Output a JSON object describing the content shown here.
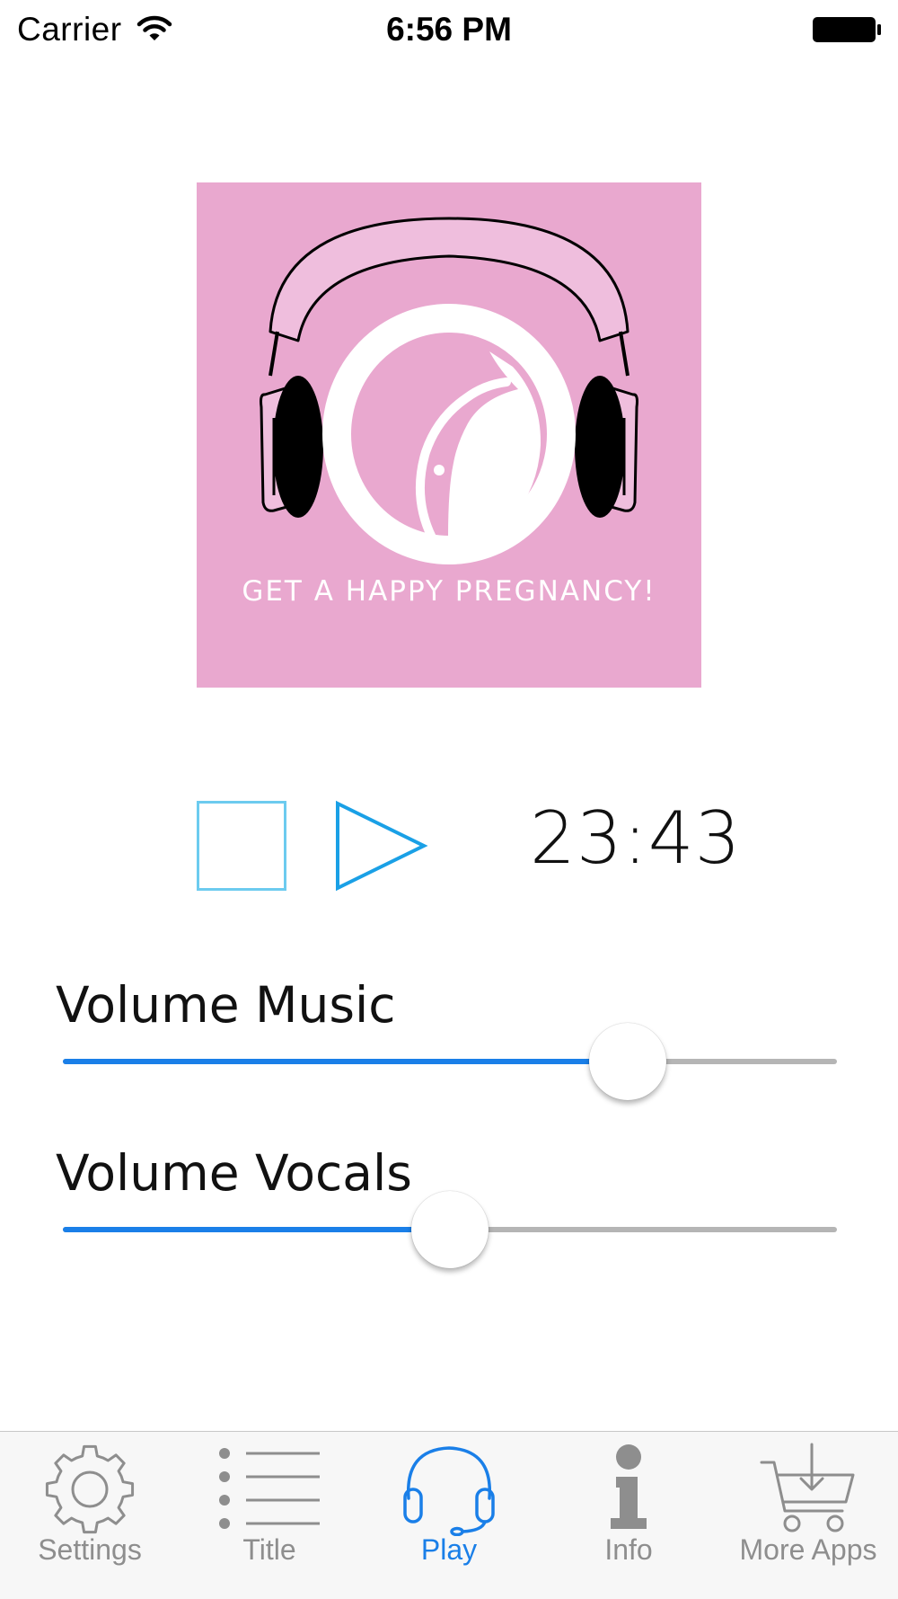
{
  "status_bar": {
    "carrier": "Carrier",
    "time": "6:56 PM"
  },
  "artwork": {
    "tagline": "GET A HAPPY PREGNANCY!",
    "background_color": "#e9a8cf"
  },
  "player": {
    "stop_icon": "stop-square-icon",
    "play_icon": "play-triangle-icon",
    "timer": "23:43"
  },
  "sliders": [
    {
      "label": "Volume Music",
      "value": 0.73
    },
    {
      "label": "Volume Vocals",
      "value": 0.5
    }
  ],
  "tab_bar": {
    "active_color": "#1a7fe8",
    "inactive_color": "#8e8e8e",
    "tabs": [
      {
        "label": "Settings",
        "icon": "gear-icon",
        "active": false
      },
      {
        "label": "Title",
        "icon": "list-icon",
        "active": false
      },
      {
        "label": "Play",
        "icon": "headphones-icon",
        "active": true
      },
      {
        "label": "Info",
        "icon": "info-icon",
        "active": false
      },
      {
        "label": "More Apps",
        "icon": "cart-download-icon",
        "active": false
      }
    ]
  }
}
